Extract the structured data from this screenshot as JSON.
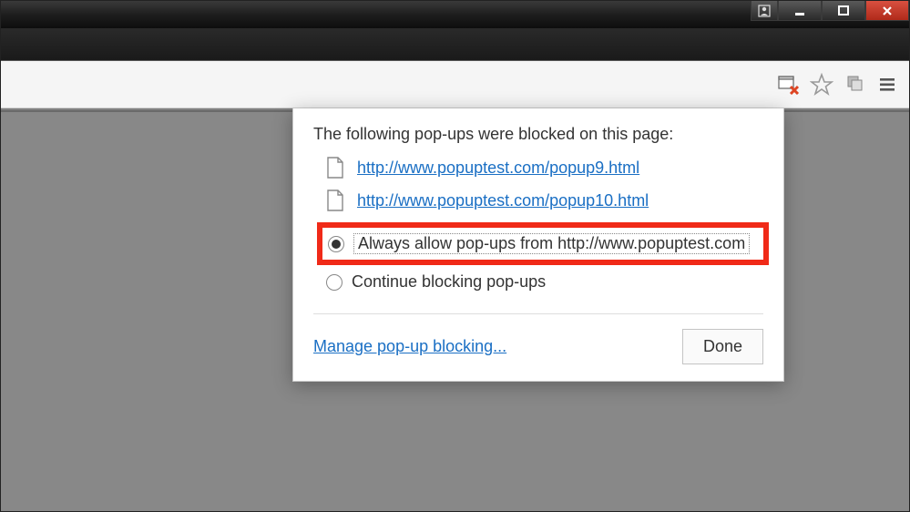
{
  "popup": {
    "heading": "The following pop-ups were blocked on this page:",
    "blocked": [
      {
        "url": "http://www.popuptest.com/popup9.html"
      },
      {
        "url": "http://www.popuptest.com/popup10.html"
      }
    ],
    "options": {
      "allow_label": "Always allow pop-ups from http://www.popuptest.com",
      "block_label": "Continue blocking pop-ups",
      "selected": "allow"
    },
    "manage_label": "Manage pop-up blocking...",
    "done_label": "Done"
  }
}
